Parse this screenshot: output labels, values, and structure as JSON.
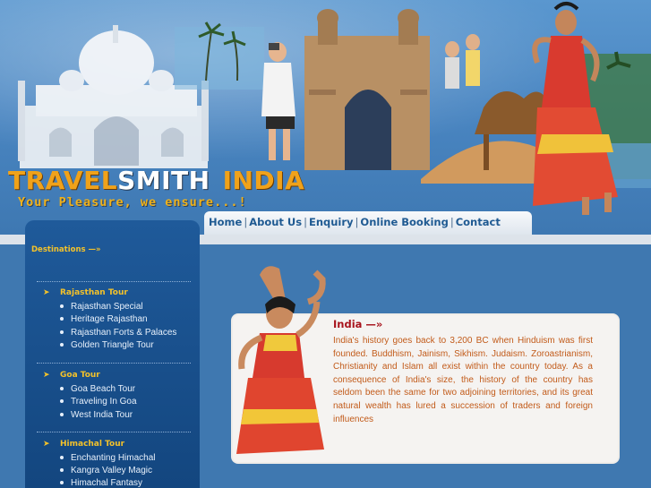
{
  "brand": {
    "word1": "TRAVEL",
    "word2": "SMITH",
    "word3": "INDIA",
    "tagline": "Your Pleasure, we ensure...!"
  },
  "nav": {
    "items": [
      "Home",
      "About Us",
      "Enquiry",
      "Online Booking",
      "Contact"
    ],
    "separator": "|"
  },
  "sidebar": {
    "heading": "Destinations —»",
    "sections": [
      {
        "title": "Rajasthan Tour",
        "items": [
          "Rajasthan Special",
          "Heritage Rajasthan",
          "Rajasthan Forts & Palaces",
          "Golden Triangle Tour"
        ]
      },
      {
        "title": "Goa Tour",
        "items": [
          "Goa Beach Tour",
          "Traveling In Goa",
          "West India Tour"
        ]
      },
      {
        "title": "Himachal Tour",
        "items": [
          "Enchanting Himachal",
          "Kangra Valley Magic",
          "Himachal Fantasy"
        ]
      }
    ]
  },
  "content": {
    "title": "India —»",
    "body": "India's history goes back to 3,200 BC when Hinduism was first founded. Buddhism, Jainism, Sikhism. Judaism. Zoroastrianism, Christianity and Islam all exist within the country today. As a consequence of India's size, the history of the country has seldom been the same for two adjoining territories, and its great natural wealth has lured a succession of traders and foreign influences"
  },
  "colors": {
    "accent_gold": "#f0a21a",
    "nav_text": "#1f5a92",
    "sidebar_bg": "#1a5090",
    "content_title": "#a8141d",
    "content_text": "#c25b1a"
  },
  "icons": {
    "sidebar_section": "hand-pointer-icon",
    "sidebar_item": "bullet-icon"
  }
}
